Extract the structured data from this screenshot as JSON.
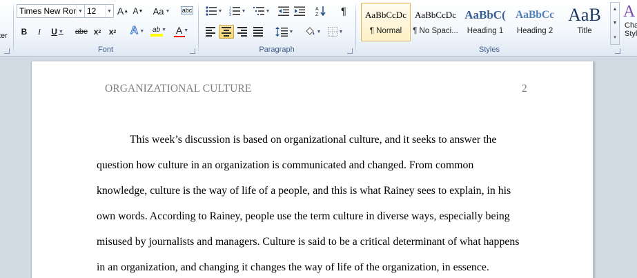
{
  "ribbon": {
    "clipboard_partial_label": "ter",
    "font_group": {
      "label": "Font",
      "font_name": "Times New Rom",
      "font_size": "12",
      "grow_font": "A",
      "shrink_font": "A",
      "change_case": "Aa",
      "clear_format": "abc",
      "bold": "B",
      "italic": "I",
      "underline": "U",
      "strikethrough": "abe",
      "subscript": "x",
      "superscript": "x",
      "text_effects": "A",
      "highlight": "ab",
      "font_color": "A"
    },
    "paragraph_group": {
      "label": "Paragraph",
      "pilcrow": "¶"
    },
    "styles_group": {
      "label": "Styles",
      "styles": [
        {
          "sample": "AaBbCcDc",
          "name": "¶ Normal",
          "selected": true
        },
        {
          "sample": "AaBbCcDc",
          "name": "¶ No Spaci...",
          "selected": false
        },
        {
          "sample": "AaBbC(",
          "name": "Heading 1",
          "selected": false
        },
        {
          "sample": "AaBbCc",
          "name": "Heading 2",
          "selected": false
        },
        {
          "sample": "AaB",
          "name": "Title",
          "selected": false
        }
      ],
      "change_styles_partial": [
        "Cha",
        "Styl"
      ]
    }
  },
  "document": {
    "running_head": "ORGANIZATIONAL CULTURE",
    "page_number": "2",
    "lines": [
      "This week’s discussion is based on organizational culture, and it seeks to answer the",
      "question how culture in an organization is communicated and changed. From common",
      "knowledge, culture is the way of life of a people, and this is what Rainey sees to explain, in his",
      "own words. According to Rainey, people use the term culture in diverse ways, especially being",
      "misused by journalists and managers.  Culture is said to be a critical determinant of what happens",
      "in an organization, and changing it changes the way of life of the organization, in essence."
    ]
  },
  "colors": {
    "accent_blue": "#1e395b",
    "heading_blue": "#365f91",
    "heading2_blue": "#4f81bd",
    "title_navy": "#17365d",
    "highlight_yellow": "#ffff00",
    "font_color_red": "#ff0000",
    "selected_style_border": "#e2b755"
  },
  "icons": [
    "format-painter-icon",
    "grow-font-icon",
    "shrink-font-icon",
    "change-case-icon",
    "clear-formatting-icon",
    "text-effects-icon",
    "highlighter-icon",
    "font-color-icon",
    "bullets-icon",
    "numbering-icon",
    "multilevel-list-icon",
    "decrease-indent-icon",
    "increase-indent-icon",
    "sort-icon",
    "show-formatting-icon",
    "align-left-icon",
    "align-center-icon",
    "align-right-icon",
    "justify-icon",
    "line-spacing-icon",
    "shading-icon",
    "borders-icon",
    "change-styles-icon"
  ]
}
